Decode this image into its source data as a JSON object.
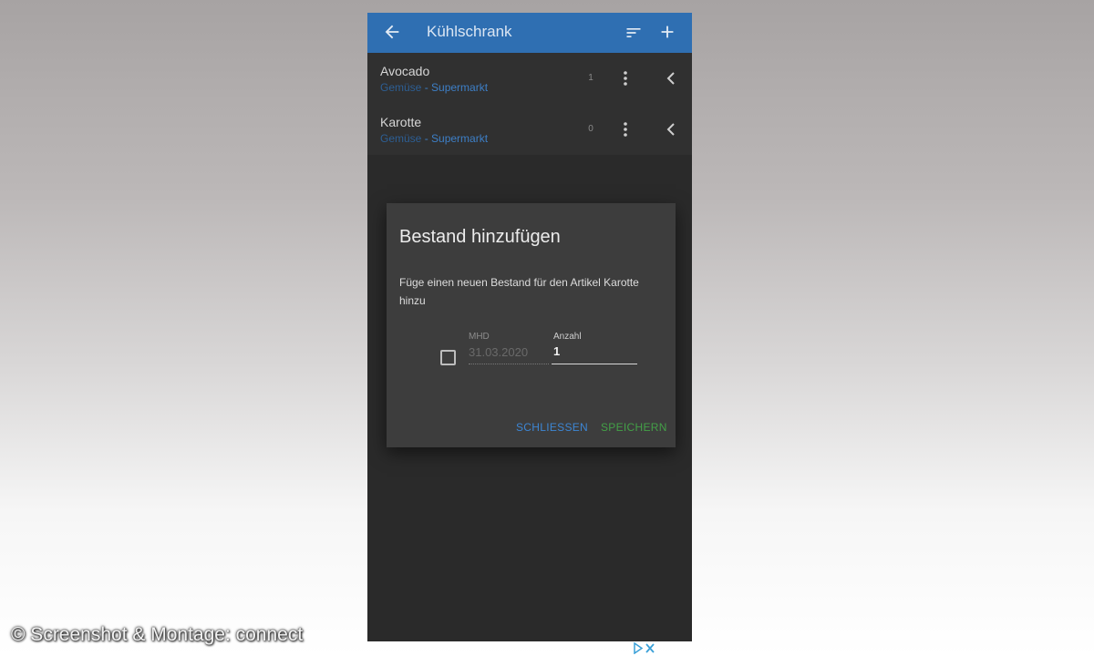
{
  "appbar": {
    "title": "Kühlschrank",
    "icons": [
      "arrow-back-icon",
      "sort-icon",
      "add-icon"
    ]
  },
  "list": {
    "items": [
      {
        "name": "Avocado",
        "category": "Gemüse",
        "location": "- Supermarkt",
        "count": "1"
      },
      {
        "name": "Karotte",
        "category": "Gemüse",
        "location": "- Supermarkt",
        "count": "0"
      }
    ]
  },
  "dialog": {
    "title": "Bestand hinzufügen",
    "message": "Füge einen neuen Bestand für den Artikel Karotte hinzu",
    "mhd_label": "MHD",
    "mhd_value": "31.03.2020",
    "anzahl_label": "Anzahl",
    "anzahl_value": "1",
    "close_label": "SCHLIESSEN",
    "save_label": "SPEICHERN"
  },
  "credit": "© Screenshot & Montage: connect",
  "colors": {
    "appbar": "#2f6fb2",
    "background": "#2a2a2a",
    "dialog": "#3d3d3d",
    "accent_blue": "#3d86d4",
    "accent_green": "#43a047"
  }
}
